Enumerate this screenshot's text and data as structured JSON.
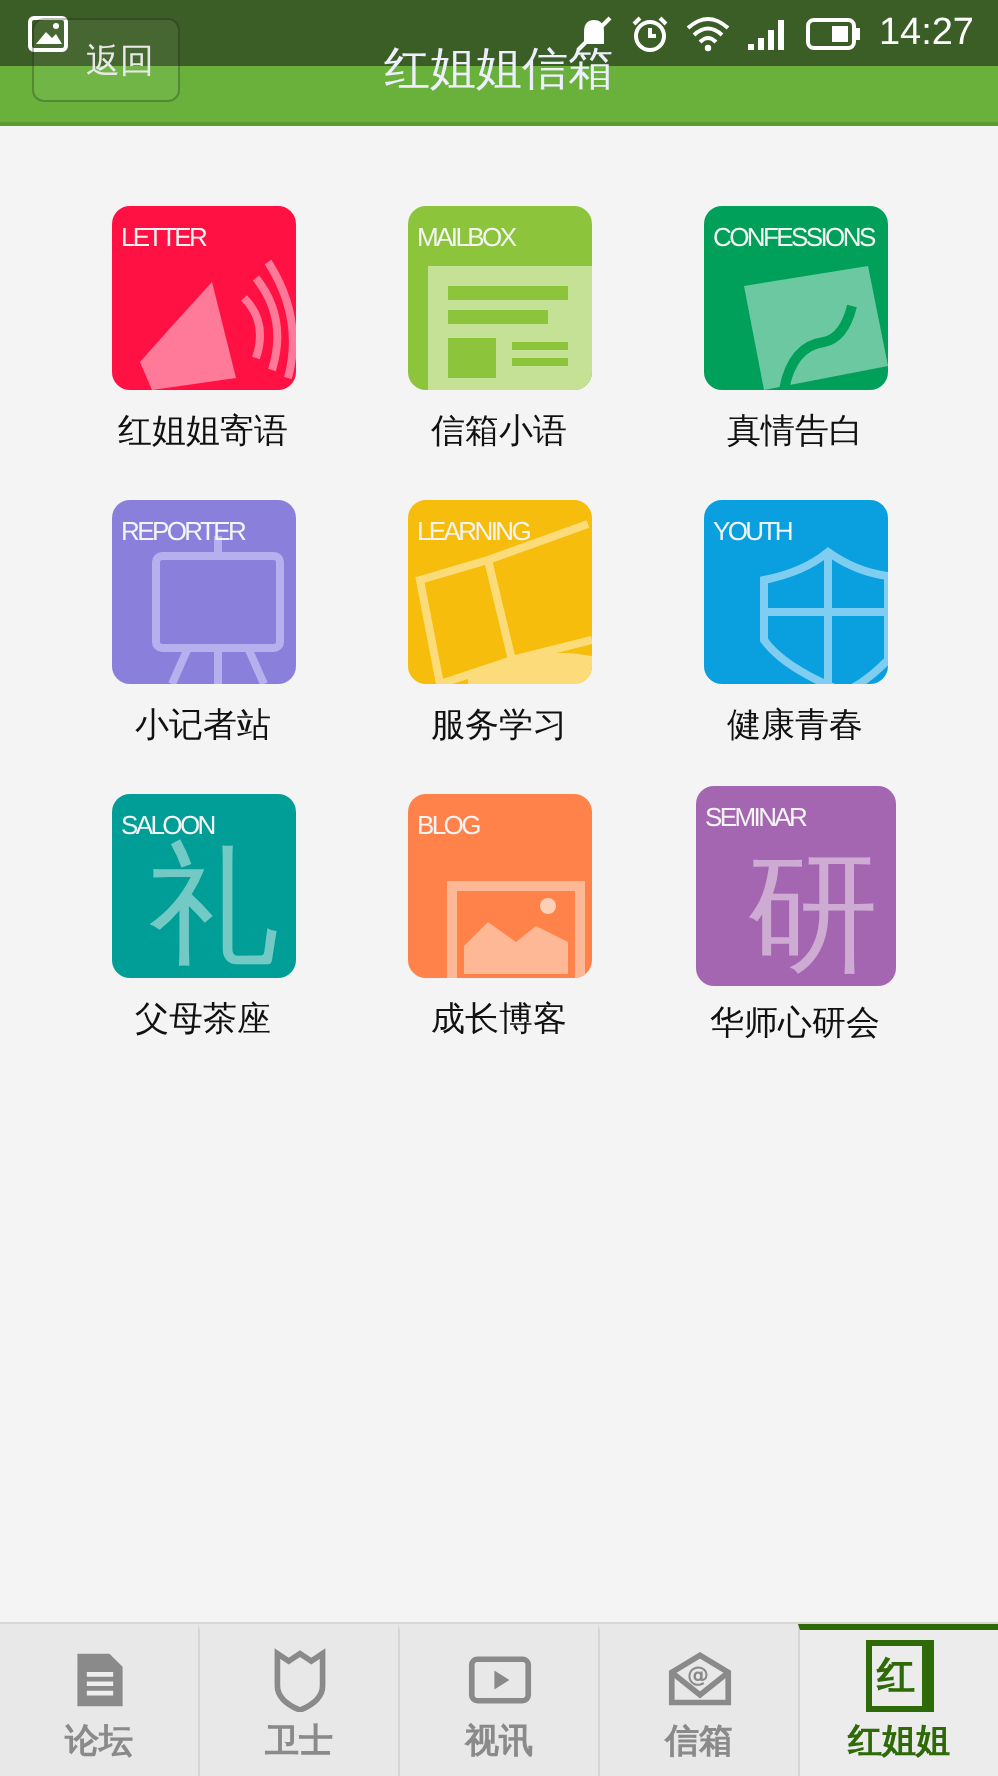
{
  "status_bar": {
    "time": "14:27"
  },
  "header": {
    "back": "返回",
    "title": "红姐姐信箱"
  },
  "tiles": [
    {
      "label": "红姐姐寄语",
      "tag": "LETTER",
      "color": "#ff1144",
      "kind": "megaphone"
    },
    {
      "label": "信箱小语",
      "tag": "MAILBOX",
      "color": "#8cc43c",
      "kind": "newspaper"
    },
    {
      "label": "真情告白",
      "tag": "CONFESSIONS",
      "color": "#00a05a",
      "kind": "note"
    },
    {
      "label": "小记者站",
      "tag": "REPORTER",
      "color": "#8b7fdc",
      "kind": "easel"
    },
    {
      "label": "服务学习",
      "tag": "LEARNING",
      "color": "#f7bd0c",
      "kind": "book"
    },
    {
      "label": "健康青春",
      "tag": "YOUTH",
      "color": "#0aa0e0",
      "kind": "shield"
    },
    {
      "label": "父母茶座",
      "tag": "SALOON",
      "color": "#009e96",
      "kind": "glyph",
      "glyph": "礼"
    },
    {
      "label": "成长博客",
      "tag": "BLOG",
      "color": "#ff824a",
      "kind": "photo"
    },
    {
      "label": "华师心研会",
      "tag": "SEMINAR",
      "color": "#a466b0",
      "kind": "glyph",
      "glyph": "研",
      "large": true
    }
  ],
  "tabs": [
    {
      "label": "论坛",
      "kind": "doc",
      "selected": false
    },
    {
      "label": "卫士",
      "kind": "shield",
      "selected": false
    },
    {
      "label": "视讯",
      "kind": "video",
      "selected": false
    },
    {
      "label": "信箱",
      "kind": "mail",
      "mark": "@",
      "selected": false
    },
    {
      "label": "红姐姐",
      "kind": "book",
      "mark": "红",
      "selected": true
    }
  ]
}
